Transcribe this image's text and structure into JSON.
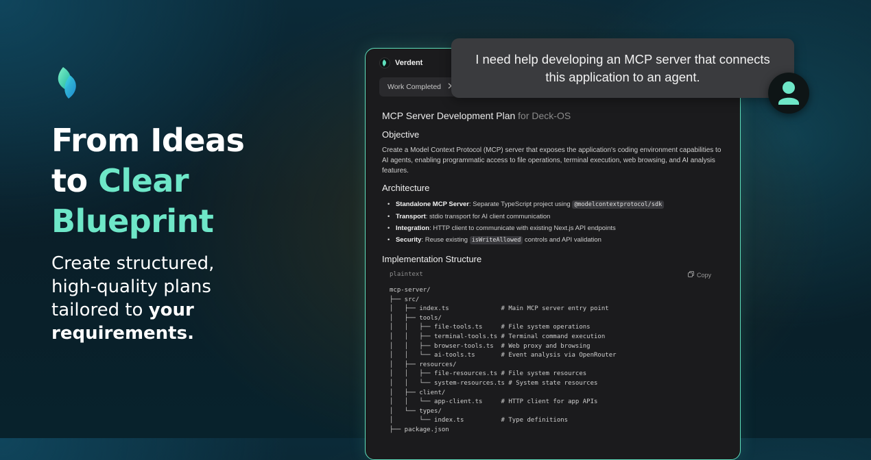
{
  "hero": {
    "headline_line1": "From Ideas",
    "headline_to": "to",
    "headline_accent_1": "Clear",
    "headline_accent_2": "Blueprint",
    "subhead_plain": "Create structured, high-quality plans tailored to",
    "subhead_bold": "your requirements."
  },
  "app": {
    "brand_name": "Verdent",
    "work_button_label": "Work Completed",
    "doc_title": "MCP Server Development Plan",
    "doc_title_suffix": "for Deck-OS",
    "objective_heading": "Objective",
    "objective_text": "Create a Model Context Protocol (MCP) server that exposes the application's coding environment capabilities to AI agents, enabling programmatic access to file operations, terminal execution, web browsing, and AI analysis features.",
    "architecture_heading": "Architecture",
    "architecture_items": [
      {
        "label": "Standalone MCP Server",
        "text": ": Separate TypeScript project using ",
        "code": "@modelcontextprotocol/sdk",
        "after": ""
      },
      {
        "label": "Transport",
        "text": ": stdio transport for AI client communication",
        "code": "",
        "after": ""
      },
      {
        "label": "Integration",
        "text": ": HTTP client to communicate with existing Next.js API endpoints",
        "code": "",
        "after": ""
      },
      {
        "label": "Security",
        "text": ": Reuse existing ",
        "code": "isWriteAllowed",
        "after": " controls and API validation"
      }
    ],
    "impl_heading": "Implementation Structure",
    "code_lang": "plaintext",
    "copy_label": "Copy",
    "code_lines": [
      "mcp-server/",
      "├── src/",
      "│   ├── index.ts              # Main MCP server entry point",
      "│   ├── tools/",
      "│   │   ├── file-tools.ts     # File system operations",
      "│   │   ├── terminal-tools.ts # Terminal command execution",
      "│   │   ├── browser-tools.ts  # Web proxy and browsing",
      "│   │   └── ai-tools.ts       # Event analysis via OpenRouter",
      "│   ├── resources/",
      "│   │   ├── file-resources.ts # File system resources",
      "│   │   └── system-resources.ts # System state resources",
      "│   ├── client/",
      "│   │   └── app-client.ts     # HTTP client for app APIs",
      "│   └── types/",
      "│       └── index.ts          # Type definitions",
      "├── package.json"
    ]
  },
  "chat": {
    "user_message": "I need help developing an MCP server that connects this application to an agent."
  },
  "colors": {
    "accent": "#6ee7c8",
    "window_border": "#5ee0bd",
    "window_bg": "#1b1b1d",
    "bubble_bg": "#3a3b3e"
  }
}
